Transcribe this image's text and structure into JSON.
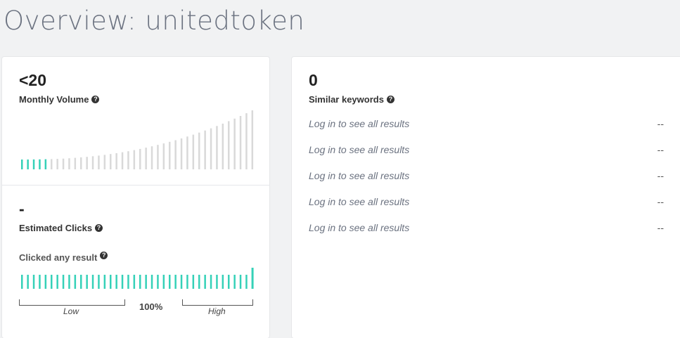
{
  "page": {
    "title": "Overview: unitedtoken"
  },
  "volume": {
    "value": "<20",
    "label": "Monthly Volume",
    "bars_total": 40,
    "bars_highlighted": 5,
    "highlight_color": "#35d1b8",
    "inactive_color": "#d9d9d9"
  },
  "clicks": {
    "value": "-",
    "label": "Estimated Clicks",
    "any_result_label": "Clicked any result",
    "bars_total": 40,
    "percent": "100%",
    "low_label": "Low",
    "high_label": "High",
    "bar_color": "#35d1b8"
  },
  "similar": {
    "count": "0",
    "label": "Similar keywords",
    "rows": [
      {
        "text": "Log in to see all results",
        "value": "--"
      },
      {
        "text": "Log in to see all results",
        "value": "--"
      },
      {
        "text": "Log in to see all results",
        "value": "--"
      },
      {
        "text": "Log in to see all results",
        "value": "--"
      },
      {
        "text": "Log in to see all results",
        "value": "--"
      }
    ]
  }
}
